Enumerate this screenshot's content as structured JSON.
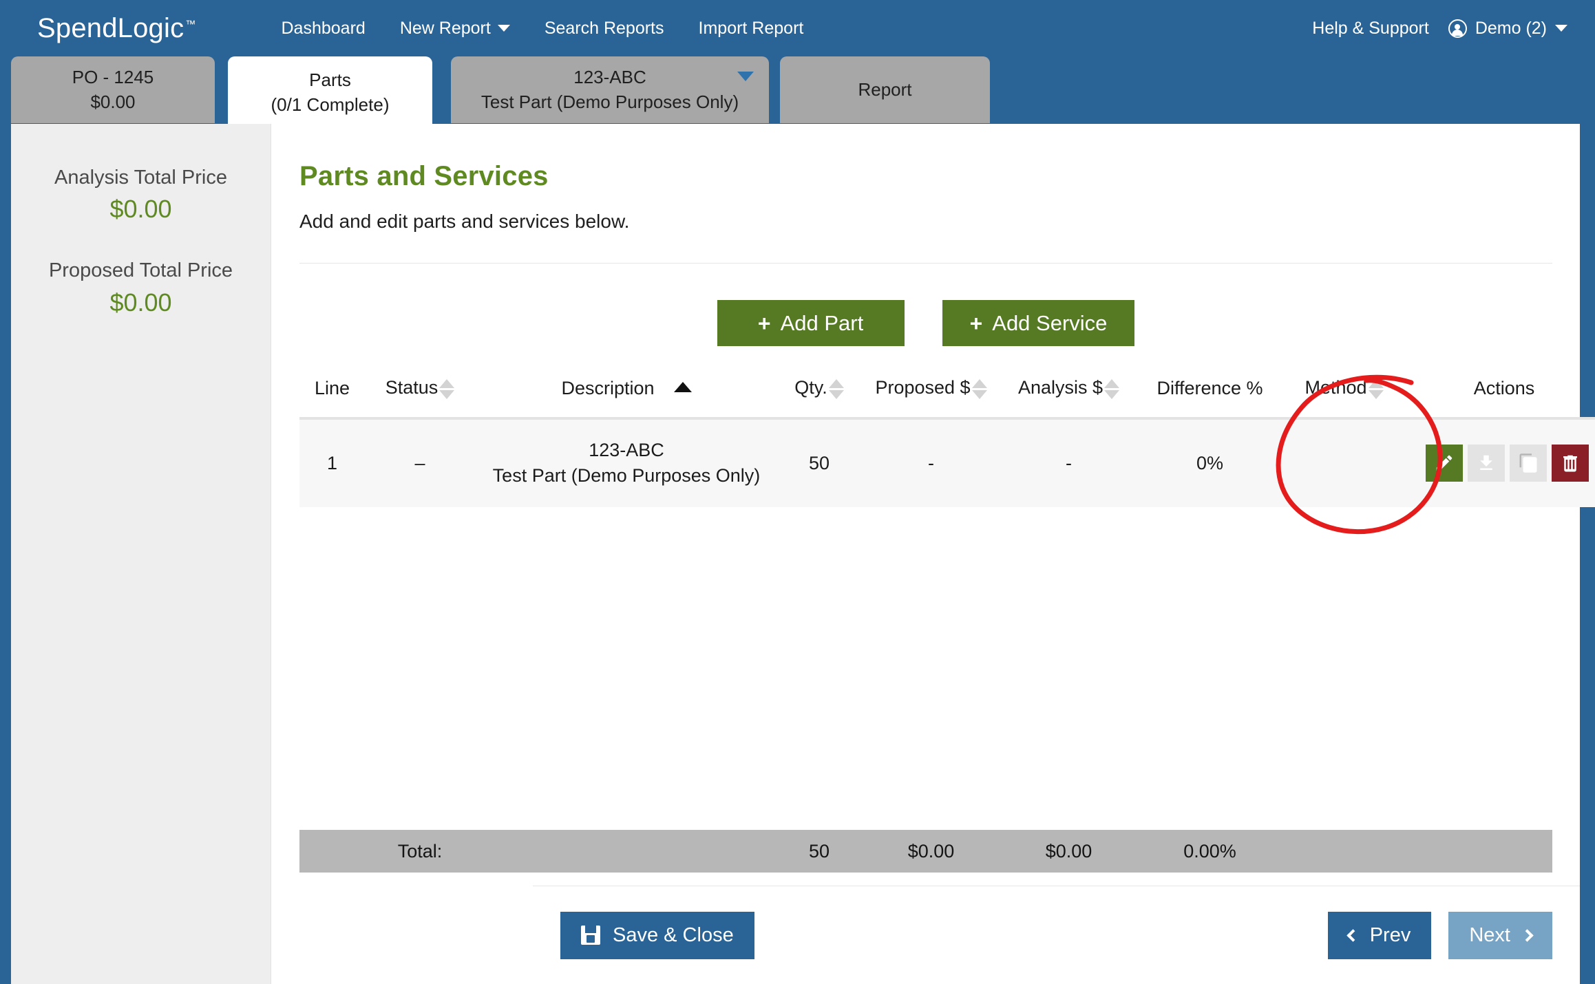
{
  "brand": {
    "name": "SpendLogic",
    "tm": "™"
  },
  "nav": {
    "links": [
      {
        "label": "Dashboard",
        "has_caret": false
      },
      {
        "label": "New Report",
        "has_caret": true
      },
      {
        "label": "Search Reports",
        "has_caret": false
      },
      {
        "label": "Import Report",
        "has_caret": false
      }
    ],
    "help": "Help & Support",
    "user": "Demo (2)"
  },
  "tabs": [
    {
      "line1": "PO - 1245",
      "line2": "$0.00",
      "active": false,
      "caret": false
    },
    {
      "line1": "Parts",
      "line2": "(0/1 Complete)",
      "active": true,
      "caret": false
    },
    {
      "line1": "123-ABC",
      "line2": "Test Part (Demo Purposes Only)",
      "active": false,
      "caret": true
    },
    {
      "line1": "Report",
      "line2": "",
      "active": false,
      "caret": false
    }
  ],
  "sidebar": {
    "blocks": [
      {
        "label": "Analysis Total Price",
        "value": "$0.00"
      },
      {
        "label": "Proposed Total Price",
        "value": "$0.00"
      }
    ]
  },
  "main": {
    "title": "Parts and Services",
    "subtitle": "Add and edit parts and services below.",
    "add_part": "Add Part",
    "add_service": "Add Service",
    "plus": "+"
  },
  "table": {
    "headers": [
      {
        "label": "Line",
        "sortable": false
      },
      {
        "label": "Status",
        "sortable": true,
        "active": false
      },
      {
        "label": "Description",
        "sortable": true,
        "active": true
      },
      {
        "label": "Qty.",
        "sortable": true,
        "active": false
      },
      {
        "label": "Proposed $",
        "sortable": true,
        "active": false
      },
      {
        "label": "Analysis $",
        "sortable": true,
        "active": false
      },
      {
        "label": "Difference %",
        "sortable": false
      },
      {
        "label": "Method",
        "sortable": true,
        "active": false
      },
      {
        "label": "Actions",
        "sortable": false
      }
    ],
    "rows": [
      {
        "line": "1",
        "status": "–",
        "desc_line1": "123-ABC",
        "desc_line2": "Test Part (Demo Purposes Only)",
        "qty": "50",
        "proposed": "-",
        "analysis": "-",
        "difference": "0%",
        "method": "",
        "actions": [
          "edit-icon",
          "download-icon",
          "copy-icon",
          "delete-icon"
        ]
      }
    ],
    "total": {
      "label": "Total:",
      "qty": "50",
      "proposed": "$0.00",
      "analysis": "$0.00",
      "difference": "0.00%"
    }
  },
  "footer": {
    "save_close": "Save & Close",
    "prev": "Prev",
    "next": "Next"
  },
  "colors": {
    "brand_blue": "#2a6496",
    "green": "#567a23",
    "green_text": "#5f8a22",
    "red_delete": "#8b1f28",
    "annotation_red": "#e41c1c",
    "tab_inactive": "#a7a7a7",
    "total_bar": "#b7b7b7"
  }
}
